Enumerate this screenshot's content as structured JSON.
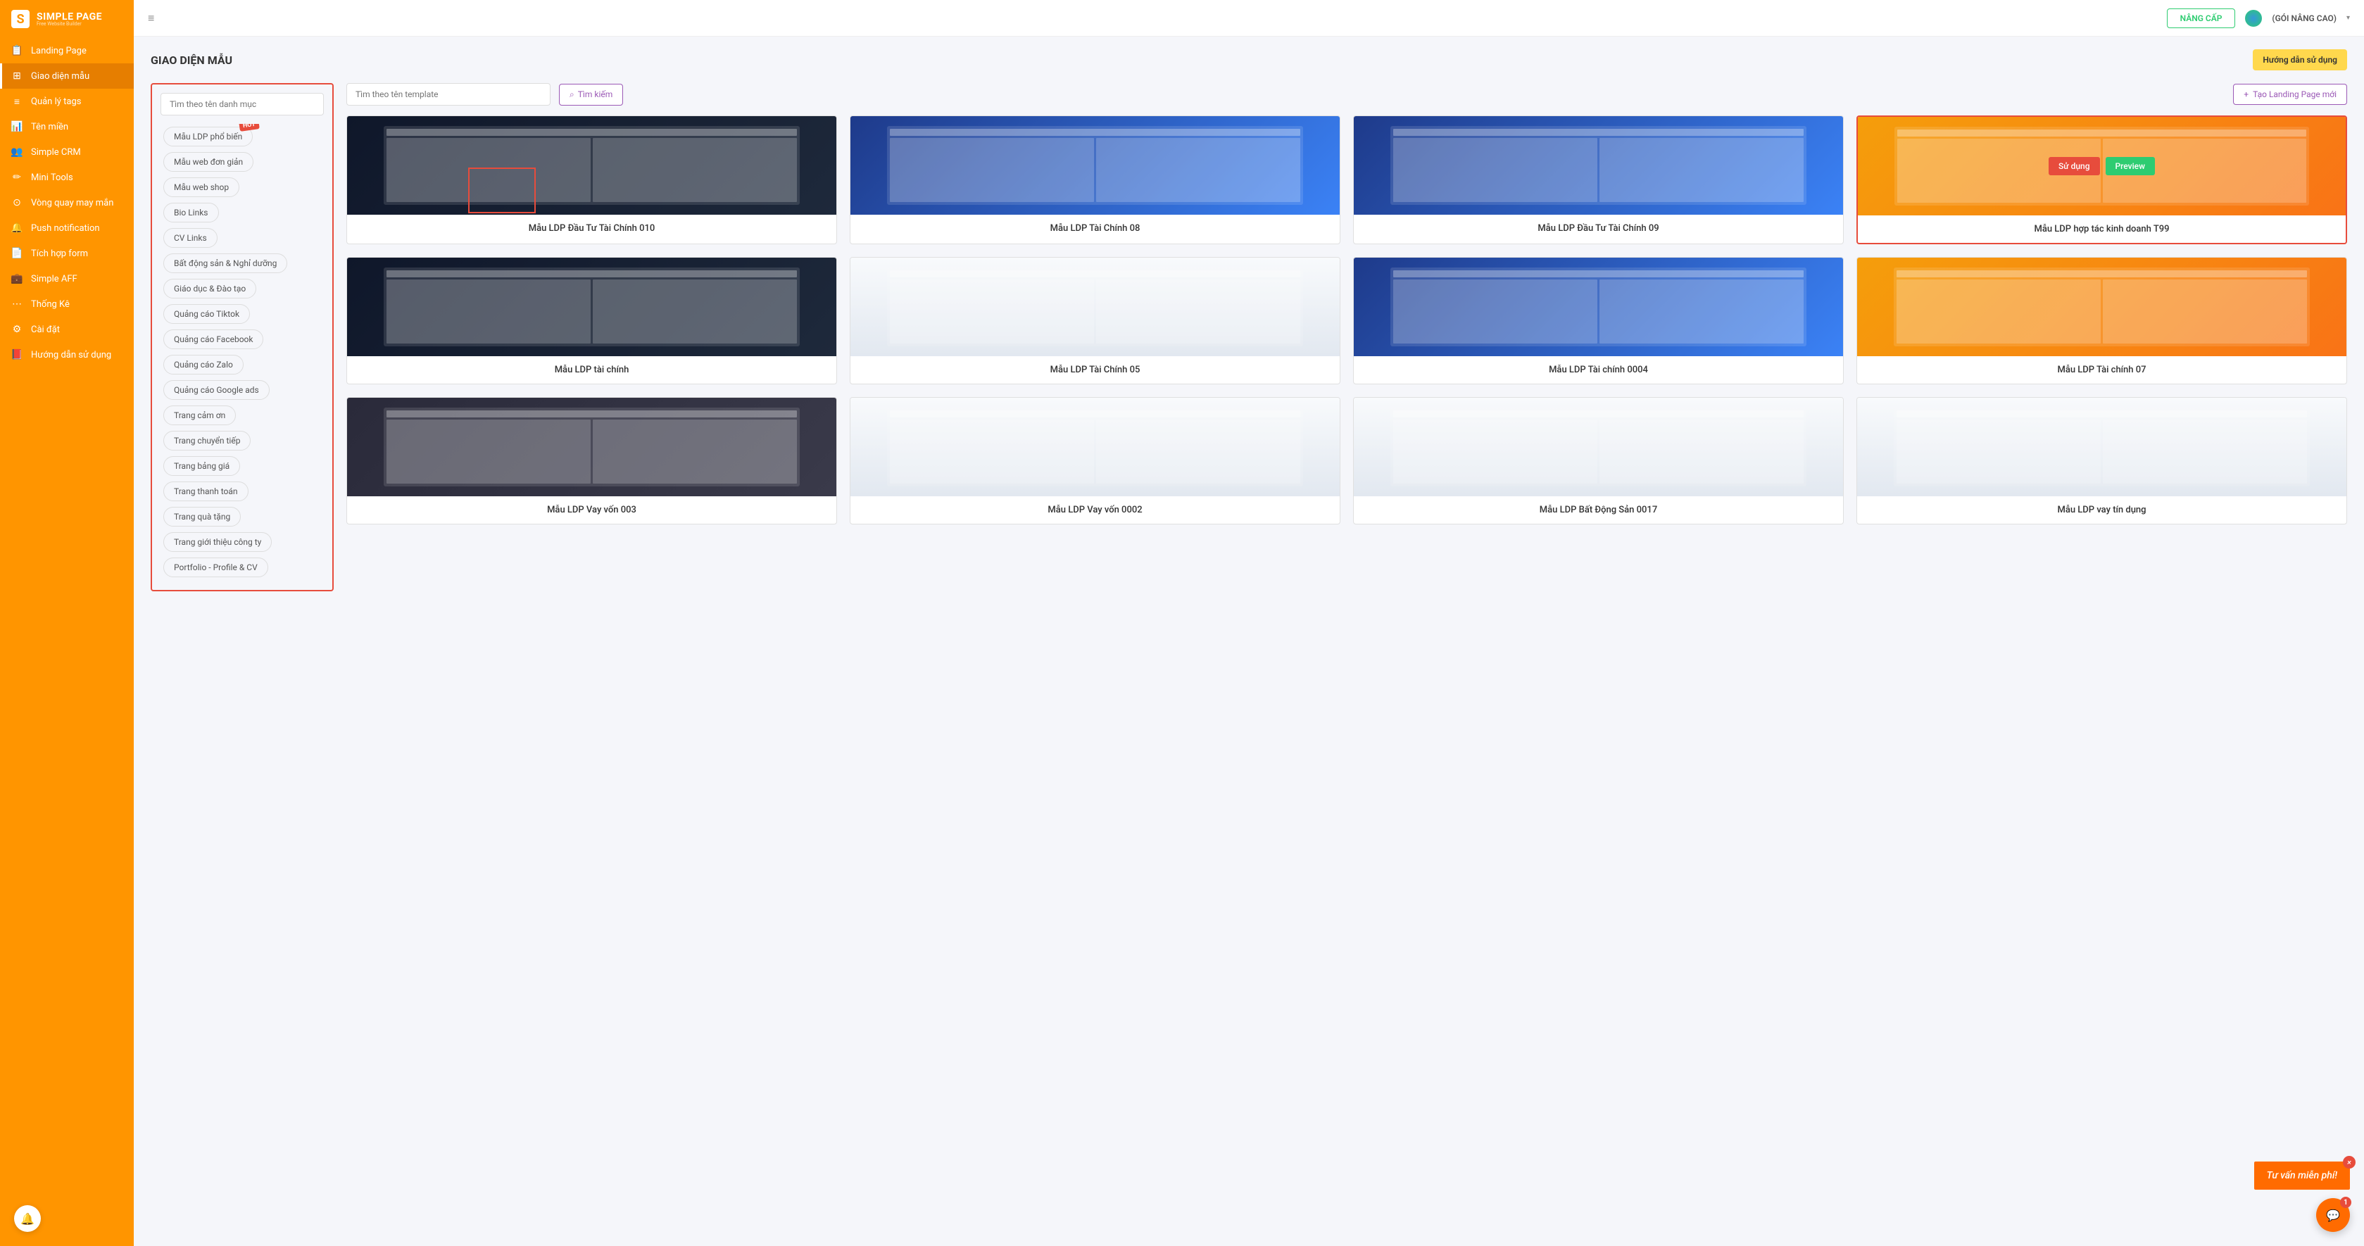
{
  "brand": {
    "name": "SIMPLE PAGE",
    "sub": "Free Website Builder"
  },
  "topbar": {
    "upgrade": "NÂNG CẤP",
    "account": "(GÓI NÂNG CAO)"
  },
  "sidebar": {
    "items": [
      {
        "label": "Landing Page",
        "icon": "📋"
      },
      {
        "label": "Giao diện mẫu",
        "icon": "⊞",
        "active": true
      },
      {
        "label": "Quản lý tags",
        "icon": "≡"
      },
      {
        "label": "Tên miền",
        "icon": "📊"
      },
      {
        "label": "Simple CRM",
        "icon": "👥"
      },
      {
        "label": "Mini Tools",
        "icon": "✏"
      },
      {
        "label": "Vòng quay may mắn",
        "icon": "⊙"
      },
      {
        "label": "Push notification",
        "icon": "🔔"
      },
      {
        "label": "Tích hợp form",
        "icon": "📄"
      },
      {
        "label": "Simple AFF",
        "icon": "💼"
      },
      {
        "label": "Thống Kê",
        "icon": "⋯"
      },
      {
        "label": "Cài đặt",
        "icon": "⚙"
      },
      {
        "label": "Hướng dẫn sử dụng",
        "icon": "📕"
      }
    ]
  },
  "content": {
    "title": "GIAO DIỆN MẪU",
    "help_btn": "Hướng dẫn sử dụng",
    "category_search_placeholder": "Tìm theo tên danh mục",
    "template_search_placeholder": "Tìm theo tên template",
    "search_btn": "Tìm kiếm",
    "create_btn": "Tạo Landing Page mới",
    "hot_label": "HOT",
    "categories": [
      "Mẫu LDP phổ biến",
      "Mẫu web đơn giản",
      "Mẫu web shop",
      "Bio Links",
      "CV Links",
      "Bất động sản & Nghỉ dưỡng",
      "Giáo dục & Đào tạo",
      "Quảng cáo Tiktok",
      "Quảng cáo Facebook",
      "Quảng cáo Zalo",
      "Quảng cáo Google ads",
      "Trang cảm ơn",
      "Trang chuyển tiếp",
      "Trang bảng giá",
      "Trang thanh toán",
      "Trang quà tặng",
      "Trang giới thiệu công ty",
      "Portfolio - Profile & CV"
    ],
    "use_btn": "Sử dụng",
    "preview_btn": "Preview",
    "templates": [
      {
        "title": "Mẫu LDP Đầu Tư Tài Chính 010",
        "style": "dark"
      },
      {
        "title": "Mẫu LDP Tài Chính 08",
        "style": "blue"
      },
      {
        "title": "Mẫu LDP Đầu Tư Tài Chính 09",
        "style": "blue"
      },
      {
        "title": "Mẫu LDP hợp tác kinh doanh T99",
        "style": "orange",
        "highlighted": true,
        "showOverlay": true
      },
      {
        "title": "Mẫu LDP tài chính",
        "style": "dark"
      },
      {
        "title": "Mẫu LDP Tài Chính 05",
        "style": "light"
      },
      {
        "title": "Mẫu LDP Tài chính 0004",
        "style": "blue"
      },
      {
        "title": "Mẫu LDP Tài chính 07",
        "style": "orange"
      },
      {
        "title": "Mẫu LDP Vay vốn 003",
        "style": "red"
      },
      {
        "title": "Mẫu LDP Vay vốn 0002",
        "style": "light"
      },
      {
        "title": "Mẫu LDP Bất Động Sản 0017",
        "style": "light"
      },
      {
        "title": "Mẫu LDP vay tín dụng",
        "style": "light"
      }
    ]
  },
  "consult": {
    "text": "Tư vấn miễn phí!",
    "badge": "1"
  }
}
